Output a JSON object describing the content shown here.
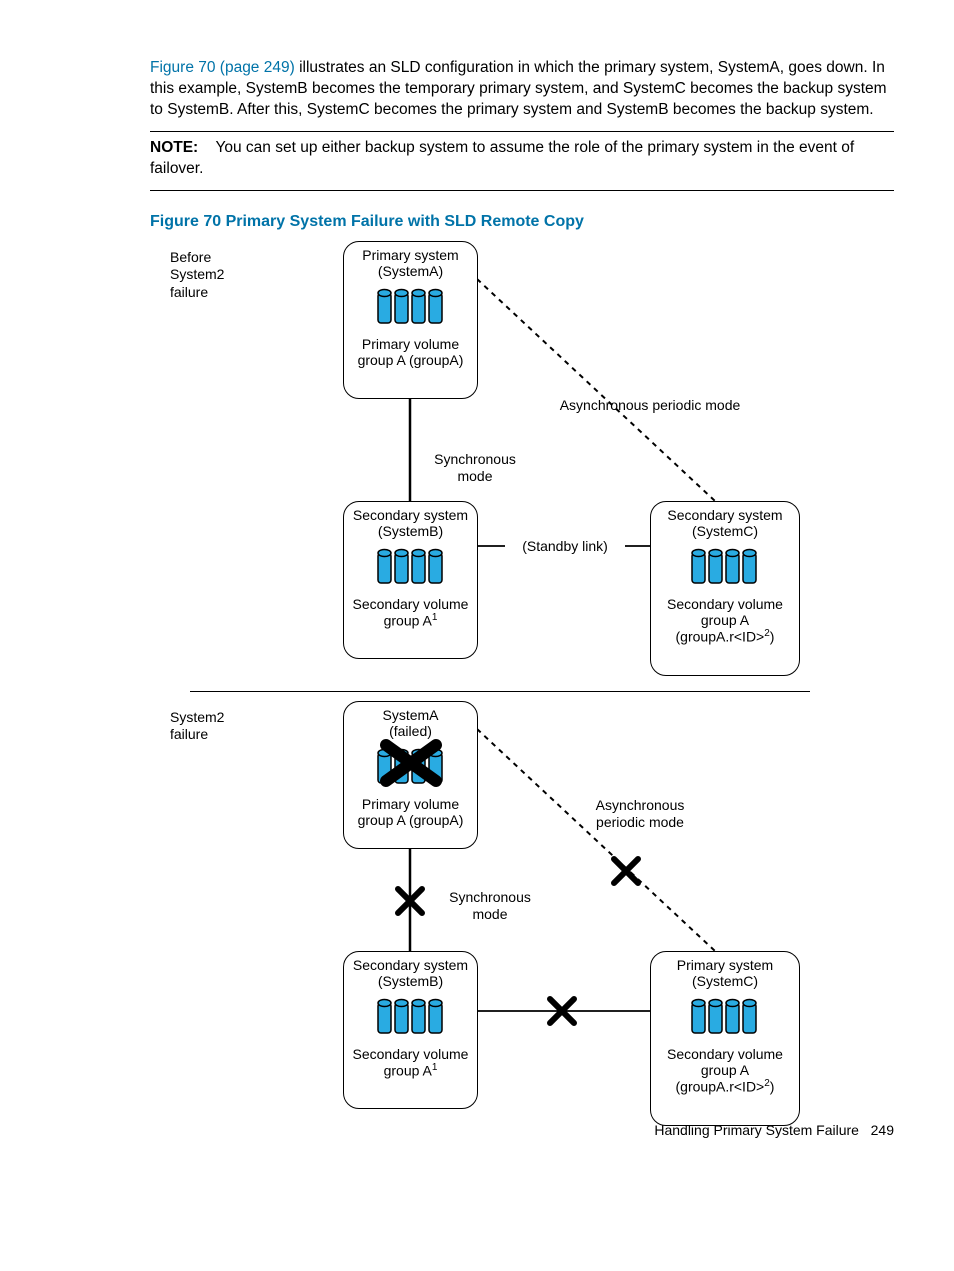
{
  "intro": {
    "link": "Figure 70 (page 249)",
    "rest": " illustrates an SLD configuration in which the primary system, SystemA, goes down. In this example, SystemB becomes the temporary primary system, and SystemC becomes the backup system to SystemB. After this, SystemC becomes the primary system and SystemB becomes the backup system."
  },
  "note": {
    "label": "NOTE:",
    "text": "You can set up either backup system to assume the role of the primary system in the event of failover."
  },
  "figure": {
    "caption": "Figure 70 Primary System Failure with SLD Remote Copy",
    "before_label_l1": "Before",
    "before_label_l2": "System2",
    "before_label_l3": "failure",
    "after_label_l1": "System2",
    "after_label_l2": "failure",
    "top": {
      "primary_l1": "Primary system",
      "primary_l2": "(SystemA)",
      "primary_vol_l1": "Primary volume",
      "primary_vol_l2": "group A (groupA)",
      "async": "Asynchronous periodic mode",
      "sync_l1": "Synchronous",
      "sync_l2": "mode",
      "standby": "(Standby link)",
      "secB_l1": "Secondary system",
      "secB_l2": "(SystemB)",
      "secB_vol_l1": "Secondary volume",
      "secB_vol_l2_a": "group A",
      "secB_vol_l2_b": "1",
      "secC_l1": "Secondary system",
      "secC_l2": "(SystemC)",
      "secC_vol_l1": "Secondary volume",
      "secC_vol_l2": "group A",
      "secC_vol_l3_a": "(groupA.r<ID>",
      "secC_vol_l3_b": "2",
      "secC_vol_l3_c": ")"
    },
    "bottom": {
      "primary_l1": "SystemA",
      "primary_l2": "(failed)",
      "primary_vol_l1": "Primary volume",
      "primary_vol_l2": "group A (groupA)",
      "async_l1": "Asynchronous",
      "async_l2": "periodic mode",
      "sync_l1": "Synchronous",
      "sync_l2": "mode",
      "secB_l1": "Secondary system",
      "secB_l2": "(SystemB)",
      "secB_vol_l1": "Secondary volume",
      "secB_vol_l2_a": "group A",
      "secB_vol_l2_b": "1",
      "secC_l1": "Primary system",
      "secC_l2": "(SystemC)",
      "secC_vol_l1": "Secondary volume",
      "secC_vol_l2": "group A",
      "secC_vol_l3_a": "(groupA.r<ID>",
      "secC_vol_l3_b": "2",
      "secC_vol_l3_c": ")"
    }
  },
  "footer": {
    "text": "Handling Primary System Failure",
    "page": "249"
  }
}
